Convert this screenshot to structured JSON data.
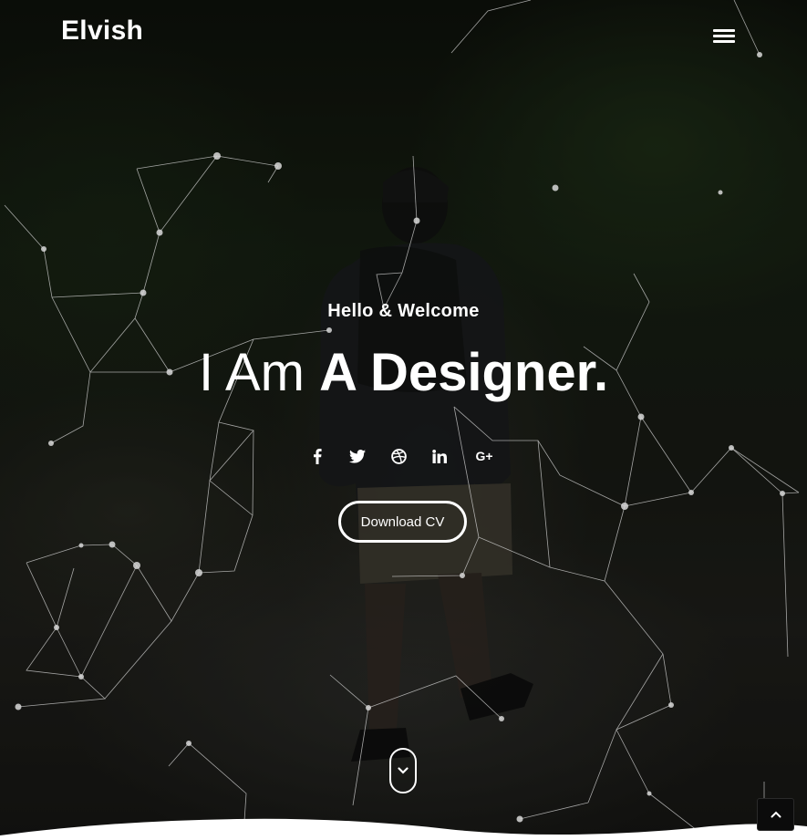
{
  "brand": {
    "name": "Elvish"
  },
  "nav": {
    "menu_icon": "hamburger-menu-icon"
  },
  "hero": {
    "greeting": "Hello & Welcome",
    "headline_prefix": "I Am",
    "headline_emphasis": "A Designer.",
    "cta_label": "Download CV"
  },
  "social_links": [
    {
      "name": "facebook",
      "icon": "facebook-icon"
    },
    {
      "name": "twitter",
      "icon": "twitter-icon"
    },
    {
      "name": "dribbble",
      "icon": "dribbble-icon"
    },
    {
      "name": "linkedin",
      "icon": "linkedin-icon"
    },
    {
      "name": "google-plus",
      "icon": "google-plus-icon",
      "glyph": "G+"
    }
  ],
  "icons": {
    "scroll": "chevron-down-icon",
    "back_to_top": "chevron-up-icon",
    "linkedin_glyph": "in"
  },
  "colors": {
    "text": "#ffffff",
    "particle": "#cfcfcf",
    "section_below": "#ffffff"
  }
}
